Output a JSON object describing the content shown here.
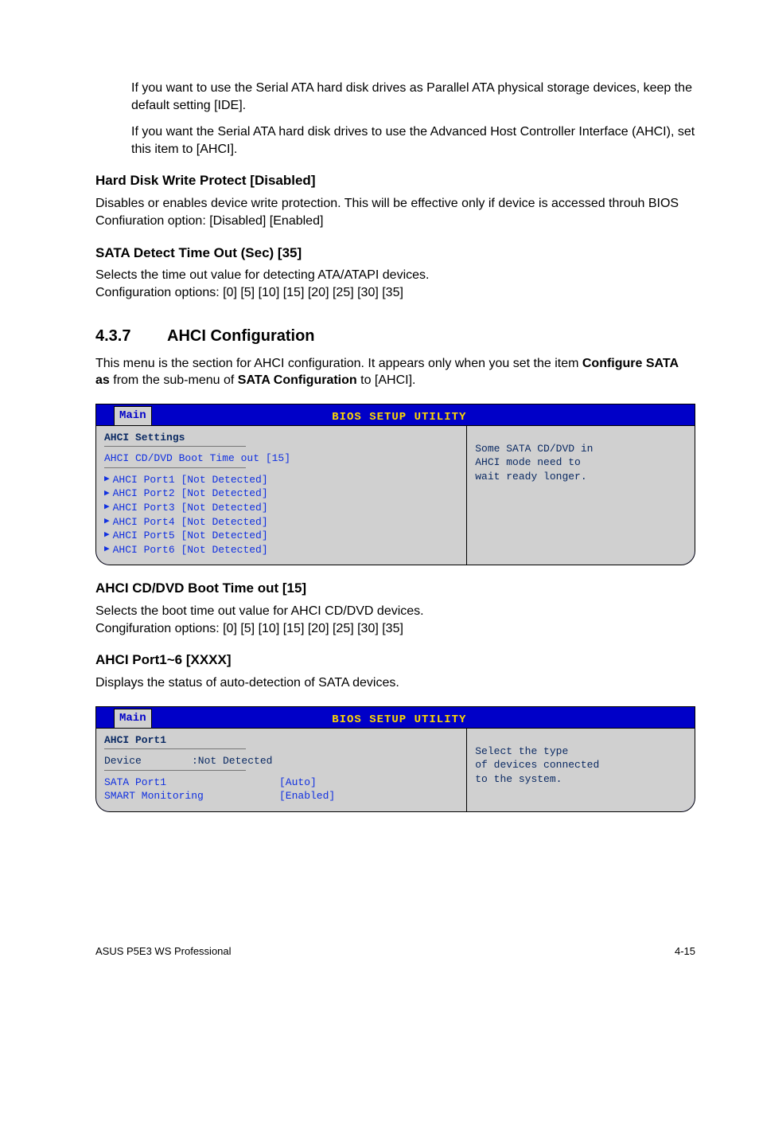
{
  "intro": {
    "p1": "If you want to use the Serial ATA hard disk drives as Parallel ATA physical storage devices, keep the default setting [IDE].",
    "p2": "If you want the Serial ATA hard disk drives to use the Advanced Host Controller Interface (AHCI), set this item to [AHCI]."
  },
  "hd_write": {
    "heading": "Hard Disk Write Protect [Disabled]",
    "desc": "Disables or enables device write protection. This will be effective only if device is accessed throuh BIOS Confiuration option: [Disabled] [Enabled]"
  },
  "sata_detect": {
    "heading": "SATA Detect Time Out (Sec) [35]",
    "desc1": "Selects the time out value for detecting ATA/ATAPI devices.",
    "desc2": "Configuration options: [0] [5] [10] [15] [20] [25] [30] [35]"
  },
  "ahci_section": {
    "number": "4.3.7",
    "title": "AHCI Configuration",
    "intro_pre": "This menu is the section for AHCI configuration. It appears only when you set the item ",
    "intro_bold1": "Configure SATA as",
    "intro_mid": " from the sub-menu of ",
    "intro_bold2": "SATA Configuration",
    "intro_post": " to [AHCI]."
  },
  "bios1": {
    "window_title": "BIOS SETUP UTILITY",
    "tab": "Main",
    "panel_title": "AHCI Settings",
    "item1": "AHCI CD/DVD Boot Time out [15]",
    "ports": [
      "AHCI Port1 [Not Detected]",
      "AHCI Port2 [Not Detected]",
      "AHCI Port3 [Not Detected]",
      "AHCI Port4 [Not Detected]",
      "AHCI Port5 [Not Detected]",
      "AHCI Port6 [Not Detected]"
    ],
    "help1": "Some SATA CD/DVD in",
    "help2": "AHCI mode need to",
    "help3": "wait ready longer."
  },
  "ahci_boot": {
    "heading": "AHCI CD/DVD Boot Time out [15]",
    "desc1": "Selects the boot time out value for AHCI CD/DVD devices.",
    "desc2": "Congifuration options: [0] [5] [10] [15] [20] [25] [30] [35]"
  },
  "ahci_port": {
    "heading": "AHCI Port1~6 [XXXX]",
    "desc": "Displays the status of auto-detection of SATA devices."
  },
  "bios2": {
    "window_title": "BIOS SETUP UTILITY",
    "tab": "Main",
    "panel_title": "AHCI Port1",
    "device_label": "Device",
    "device_value": ":Not Detected",
    "row1_label": "SATA Port1",
    "row1_value": "[Auto]",
    "row2_label": "SMART Monitoring",
    "row2_value": "[Enabled]",
    "help1": "Select the type",
    "help2": "of devices connected",
    "help3": "to the system."
  },
  "footer": {
    "left": "ASUS P5E3 WS Professional",
    "right": "4-15"
  }
}
